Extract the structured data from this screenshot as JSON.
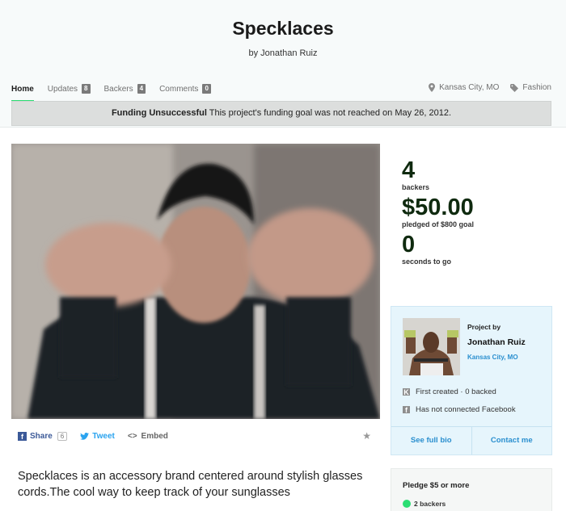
{
  "project": {
    "title": "Specklaces",
    "byline": "by Jonathan Ruiz"
  },
  "nav": {
    "home": "Home",
    "updates": {
      "label": "Updates",
      "count": "8"
    },
    "backers": {
      "label": "Backers",
      "count": "4"
    },
    "comments": {
      "label": "Comments",
      "count": "0"
    },
    "location": "Kansas City, MO",
    "category": "Fashion"
  },
  "banner": {
    "status": "Funding Unsuccessful",
    "message": " This project's funding goal was not reached on May 26, 2012."
  },
  "stats": {
    "backers_num": "4",
    "backers_label": "backers",
    "pledged_num": "$50.00",
    "pledged_label": "pledged of $800 goal",
    "time_num": "0",
    "time_label": "seconds to go"
  },
  "creator": {
    "project_by": "Project by",
    "name": "Jonathan Ruiz",
    "location": "Kansas City, MO",
    "created": "First created · 0 backed",
    "facebook": "Has not connected Facebook",
    "see_bio": "See full bio",
    "contact": "Contact me"
  },
  "share": {
    "share_label": "Share",
    "share_count": "6",
    "tweet_label": "Tweet",
    "embed_label": "Embed"
  },
  "blurb": "Specklaces is an accessory brand centered around stylish glasses cords.The cool way to keep track of your sunglasses",
  "pledge": {
    "title": "Pledge $5 or more",
    "backers": "2 backers"
  },
  "colors": {
    "accent_green": "#2bde73",
    "link_blue": "#2a8fcf",
    "facebook_blue": "#3b5998",
    "twitter_blue": "#2aa3ef"
  }
}
